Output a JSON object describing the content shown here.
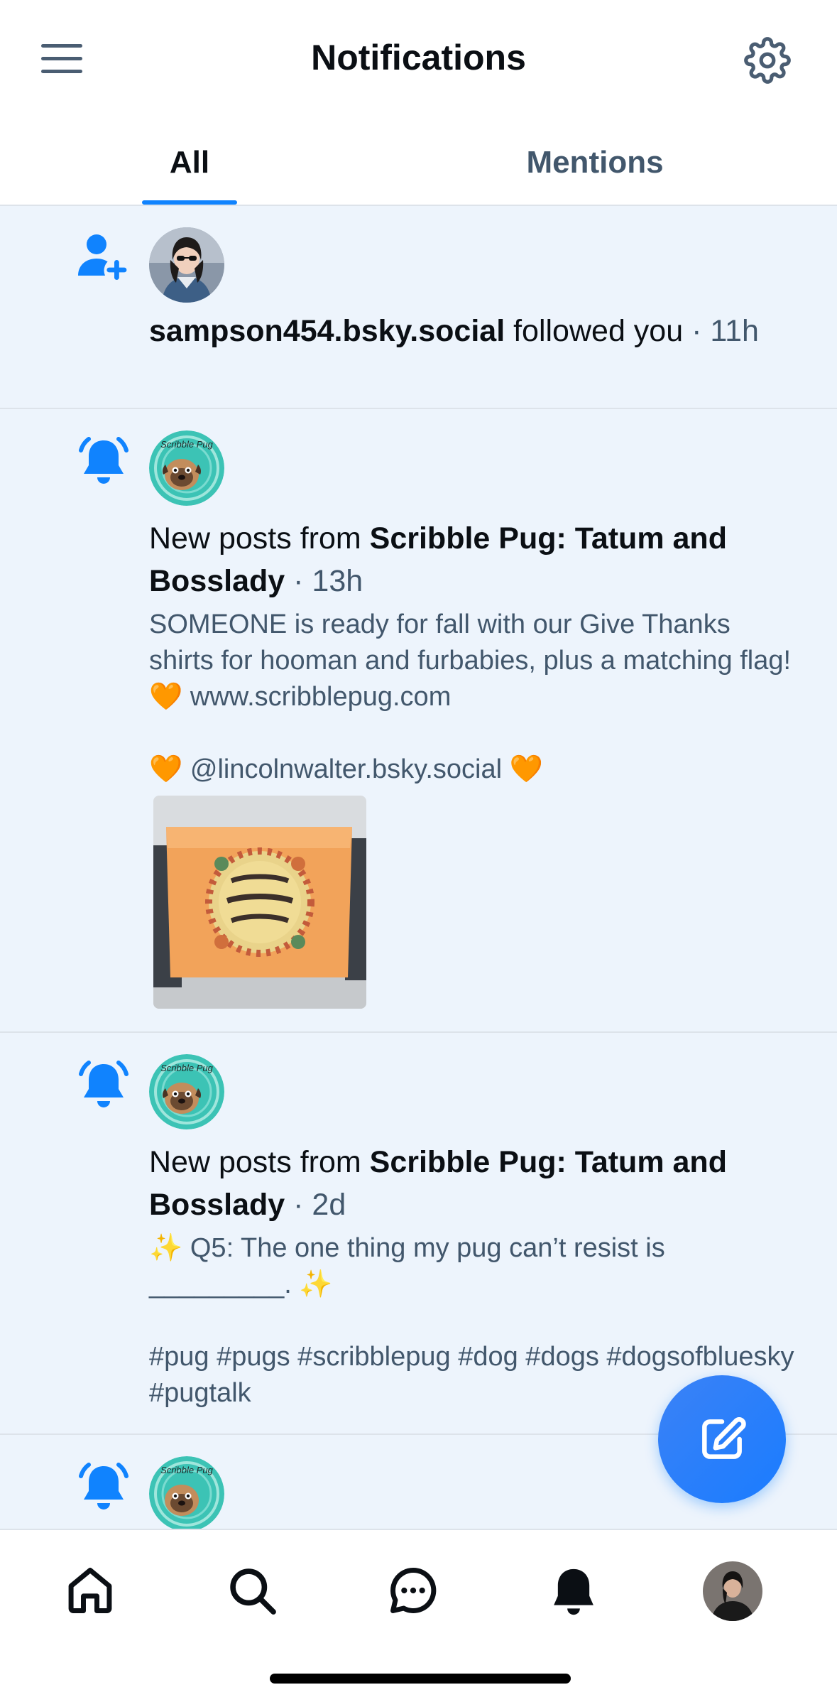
{
  "header": {
    "title": "Notifications",
    "menu_icon": "hamburger-menu-icon",
    "settings_icon": "gear-icon"
  },
  "tabs": [
    {
      "label": "All",
      "active": true
    },
    {
      "label": "Mentions",
      "active": false
    }
  ],
  "notifications": [
    {
      "type": "follow",
      "icon": "person-plus-icon",
      "handle": "sampson454.bsky.social",
      "action": "followed you",
      "time": "· 11h"
    },
    {
      "type": "new-posts",
      "icon": "bell-ringing-icon",
      "prefix": "New posts from",
      "author": "Scribble Pug: Tatum and Bosslady",
      "time": "· 13h",
      "text": "SOMEONE is ready for fall with our Give Thanks shirts for hooman and furbabies, plus a matching flag! 🧡 www.scribblepug.com\n\n🧡 @lincolnwalter.bsky.social 🧡",
      "has_image": true
    },
    {
      "type": "new-posts",
      "icon": "bell-ringing-icon",
      "prefix": "New posts from",
      "author": "Scribble Pug: Tatum and Bosslady",
      "time": "· 2d",
      "text": "✨ Q5: The one thing my pug can’t resist is _________. ✨\n\n#pug #pugs #scribblepug #dog #dogs #dogsofbluesky #pugtalk"
    },
    {
      "type": "new-posts",
      "icon": "bell-ringing-icon"
    }
  ],
  "fab": {
    "icon": "compose-icon"
  },
  "bottom_nav": [
    {
      "icon": "home-icon"
    },
    {
      "icon": "search-icon"
    },
    {
      "icon": "chat-icon"
    },
    {
      "icon": "bell-icon",
      "active": true
    },
    {
      "icon": "profile-avatar"
    }
  ],
  "colors": {
    "accent": "#1083fe",
    "feed_bg": "#edf4fc",
    "muted_text": "#42576c"
  }
}
